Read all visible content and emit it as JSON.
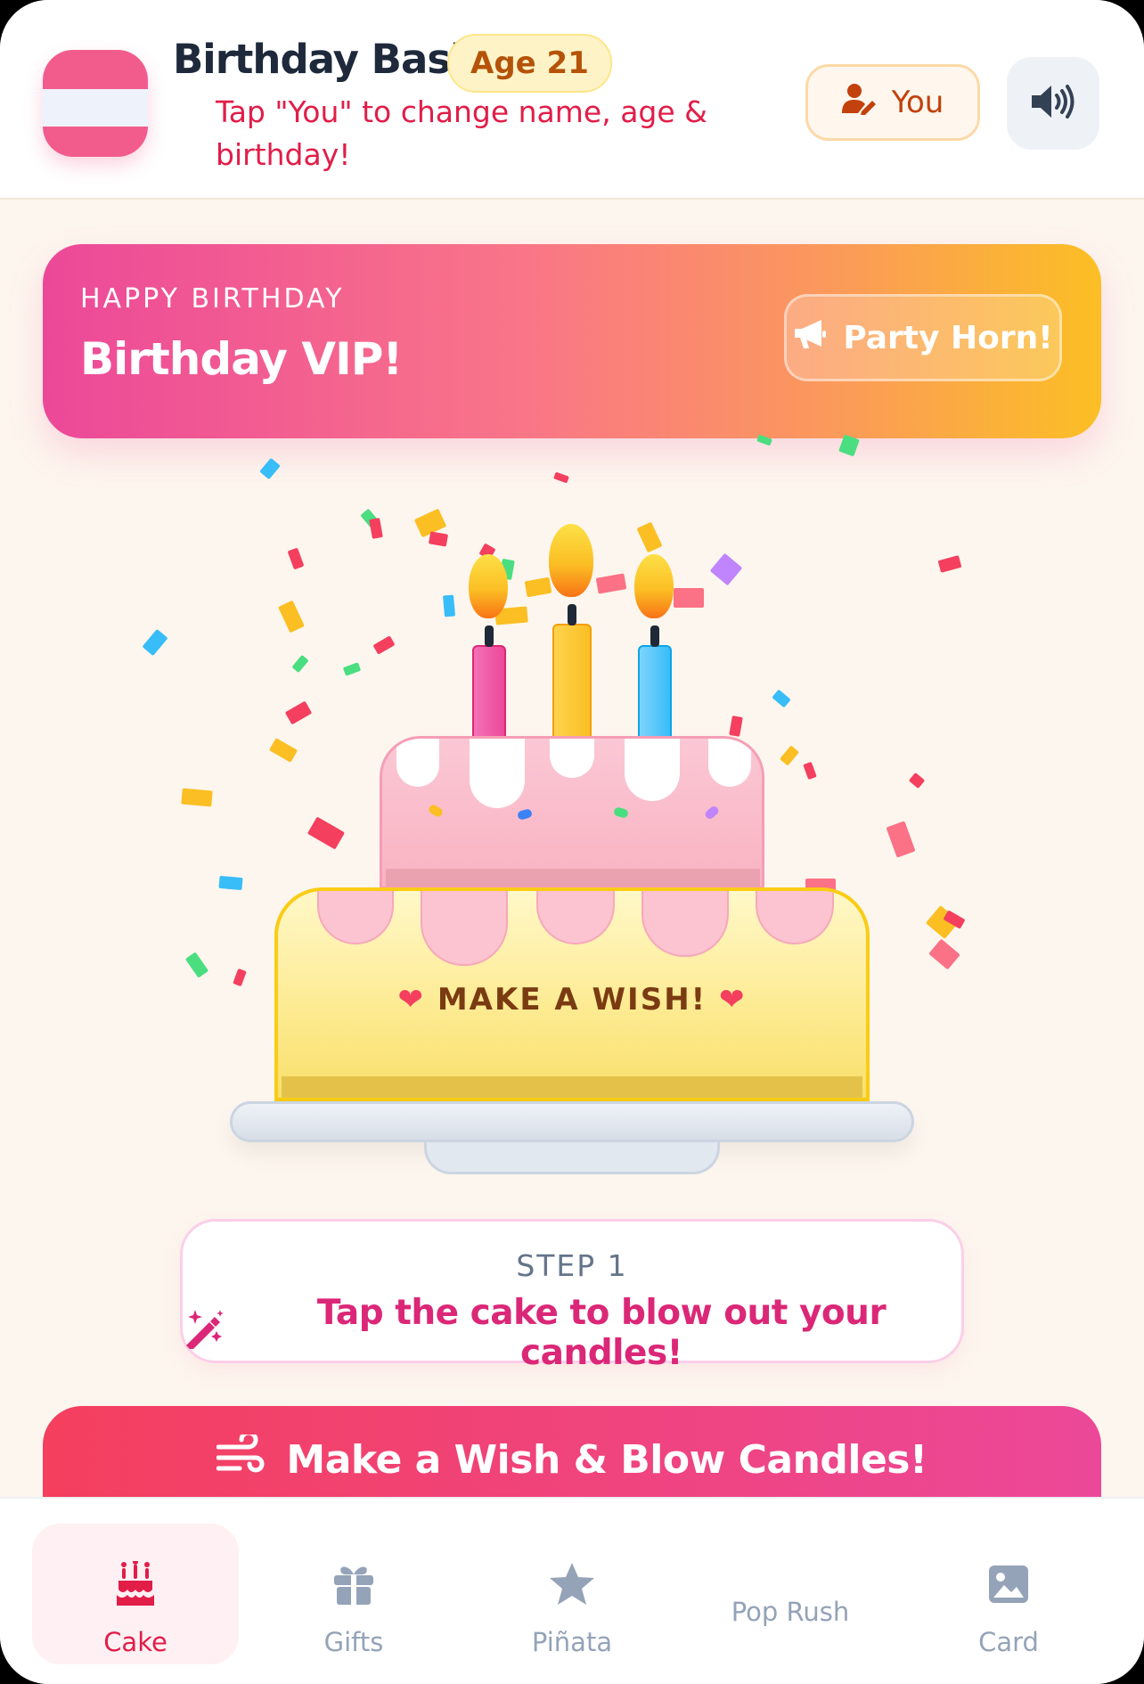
{
  "header": {
    "title": "Birthday Bash!",
    "age_badge": "Age 21",
    "hint": "Tap \"You\" to change name, age & birthday!",
    "you_label": "You"
  },
  "banner": {
    "kicker": "HAPPY BIRTHDAY",
    "title": "Birthday VIP!",
    "horn_label": "Party Horn!"
  },
  "cake": {
    "wish_text": "MAKE A WISH!",
    "candle_count": 3,
    "candle_colors": [
      "#f472b6",
      "#fbbf24",
      "#38bdf8"
    ]
  },
  "step": {
    "label": "STEP 1",
    "text": "Tap the cake to blow out your candles!"
  },
  "cta": {
    "label": "Make a Wish & Blow Candles!"
  },
  "nav": {
    "items": [
      {
        "label": "Cake",
        "icon": "cake-icon",
        "active": true
      },
      {
        "label": "Gifts",
        "icon": "gift-icon",
        "active": false
      },
      {
        "label": "Piñata",
        "icon": "star-icon",
        "active": false
      },
      {
        "label": "Pop Rush",
        "icon": "",
        "active": false
      },
      {
        "label": "Card",
        "icon": "image-icon",
        "active": false
      }
    ]
  },
  "colors": {
    "accent": "#e11d48",
    "pink": "#ec4899",
    "amber": "#fbbf24",
    "background": "#fdf6ee"
  }
}
